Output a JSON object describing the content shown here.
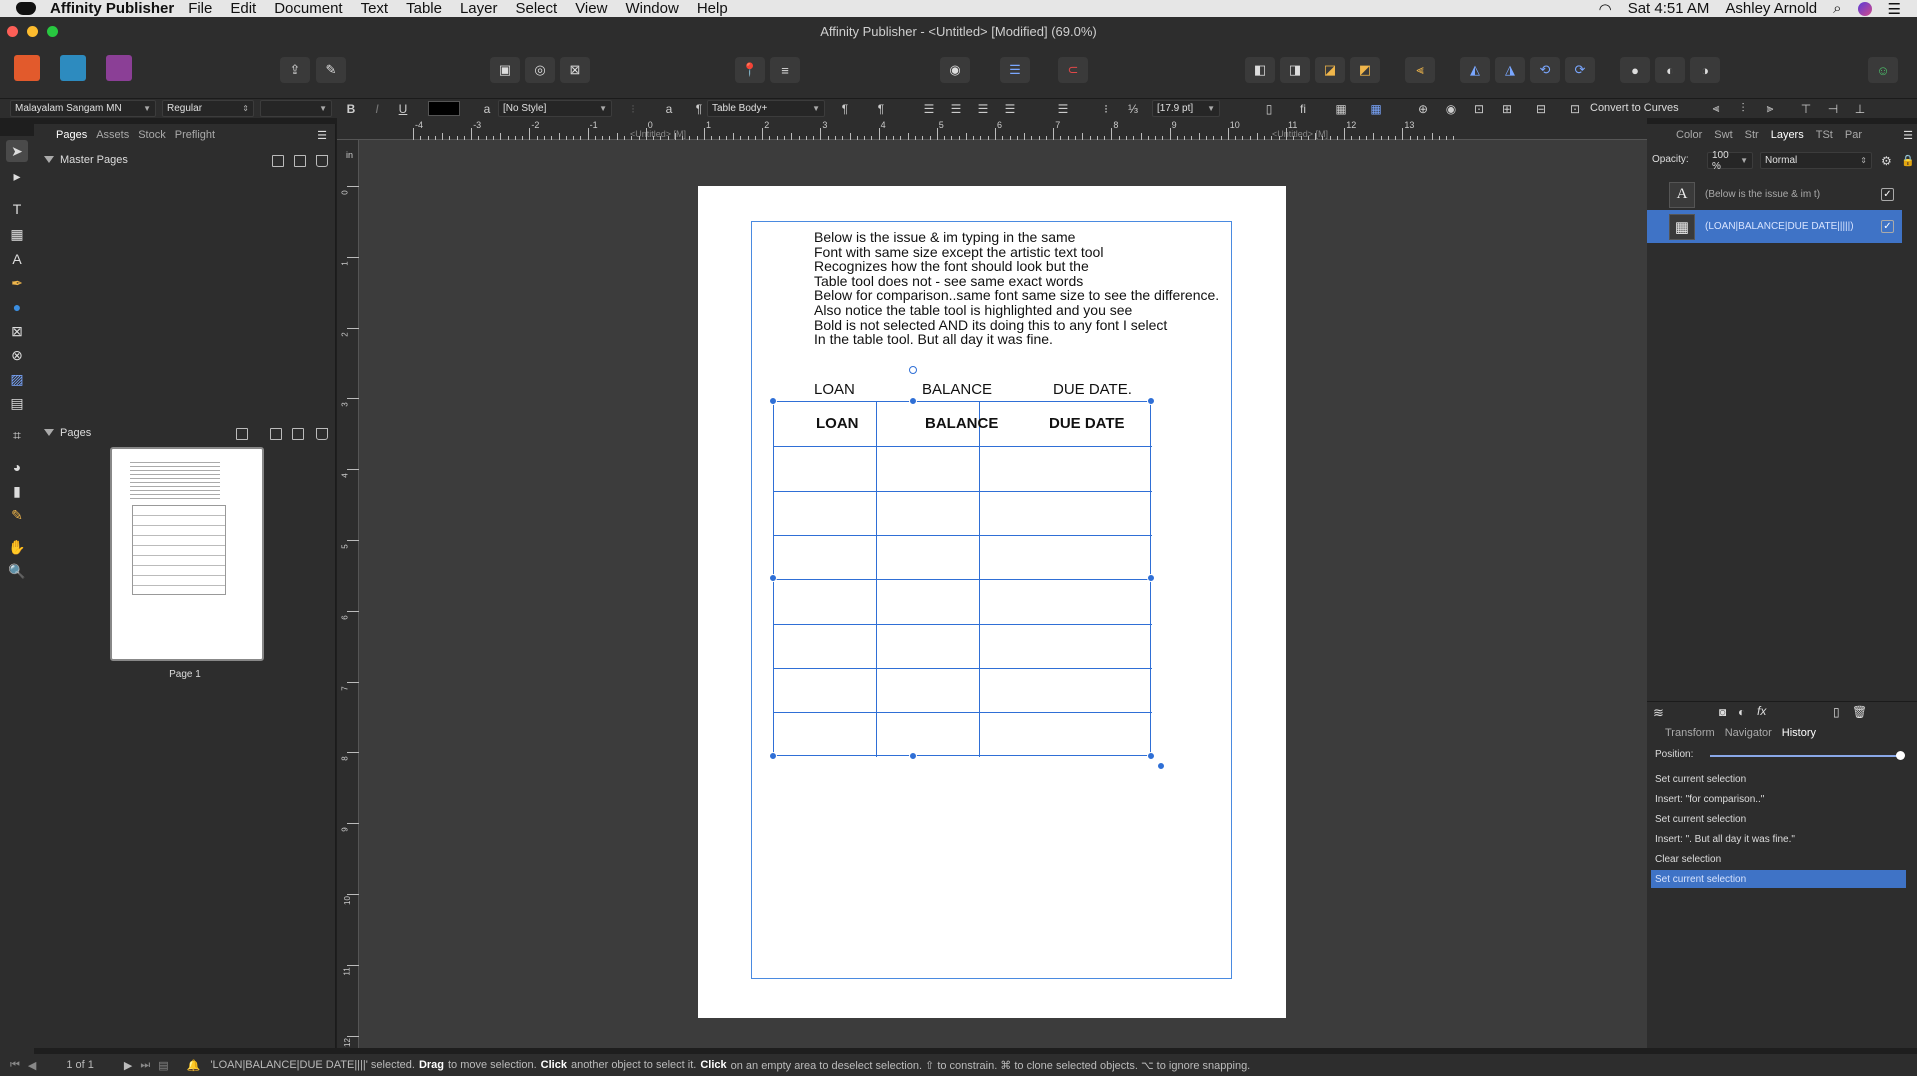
{
  "menubar": {
    "app": "Affinity Publisher",
    "items": [
      "File",
      "Edit",
      "Document",
      "Text",
      "Table",
      "Layer",
      "Select",
      "View",
      "Window",
      "Help"
    ],
    "clock": "Sat 4:51 AM",
    "user": "Ashley Arnold"
  },
  "window": {
    "title": "Affinity Publisher - <Untitled> [Modified] (69.0%)"
  },
  "context_bar": {
    "font_family": "Malayalam Sangam MN",
    "font_style": "Regular",
    "char_style": "[No Style]",
    "para_style": "Table Body+",
    "leading": "[17.9 pt]",
    "convert_label": "Convert to Curves",
    "bold": "B",
    "italic": "I",
    "underline": "U"
  },
  "left_panel": {
    "tabs": [
      "Pages",
      "Assets",
      "Stock",
      "Preflight"
    ],
    "master_pages": "Master Pages",
    "pages_section": "Pages",
    "page_label": "Page 1"
  },
  "doc_tabs": {
    "left": "<Untitled> [M]",
    "right": "<Untitled> [M]"
  },
  "ruler": {
    "unit": "in",
    "labels": [
      "-4",
      "-3",
      "-2",
      "-1",
      "0",
      "1",
      "2",
      "3",
      "4",
      "5",
      "6",
      "7",
      "8",
      "9",
      "10",
      "11",
      "12",
      "13"
    ],
    "vlabels": [
      "0",
      "1",
      "2",
      "3",
      "4",
      "5",
      "6",
      "7",
      "8",
      "9",
      "10",
      "11",
      "12"
    ]
  },
  "document": {
    "text_lines": [
      "Below is the issue & im typing in the same",
      "Font with same size except the artistic text tool",
      "Recognizes how the font should look but the",
      "Table tool does not - see same exact words",
      "Below for comparison..same font same size to see the difference.",
      "Also notice the table tool is highlighted and you see",
      "Bold is not selected AND its doing this to any font I select",
      "In the table tool. But all day it was fine."
    ],
    "artistic_headers": [
      "LOAN",
      "BALANCE",
      "DUE DATE."
    ],
    "table_headers": [
      "LOAN",
      "BALANCE",
      "DUE DATE"
    ]
  },
  "right_panel": {
    "tabs": [
      "Color",
      "Swt",
      "Str",
      "Layers",
      "TSt",
      "Par"
    ],
    "opacity_label": "Opacity:",
    "opacity_value": "100 %",
    "blend_mode": "Normal",
    "layers": [
      {
        "name": "(Below is the issue & im t)",
        "icon": "A"
      },
      {
        "name": "(LOAN|BALANCE|DUE DATE|||||)",
        "icon": "table"
      }
    ],
    "bottom_tabs": [
      "Transform",
      "Navigator",
      "History"
    ],
    "position_label": "Position:",
    "history": [
      "Set current selection",
      "Insert: \"for comparison..\"",
      "Set current selection",
      "Insert: \". But all day it was fine.\"",
      "Clear selection",
      "Set current selection"
    ]
  },
  "status": {
    "page_count": "1 of 1",
    "message_prefix": "'LOAN|BALANCE|DUE DATE||||' selected.",
    "drag": "Drag",
    "drag_text": "to move selection.",
    "click": "Click",
    "click_text": "another object to select it.",
    "click2": "Click",
    "click2_text": "on an empty area to deselect selection. ⇧ to constrain. ⌘ to clone selected objects. ⌥ to ignore snapping."
  },
  "colors": {
    "accent": "#2f6fd6",
    "selection": "#4a8ae0",
    "layer_selected": "#3f73c6"
  }
}
